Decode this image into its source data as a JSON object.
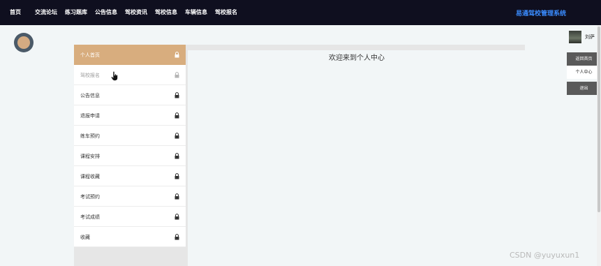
{
  "topbar": {
    "nav": [
      "首页",
      "交流论坛",
      "练习题库",
      "公告信息",
      "驾校资讯",
      "驾校信息",
      "车辆信息",
      "驾校报名"
    ],
    "brand": "易通驾校管理系统"
  },
  "sidebar": {
    "items": [
      {
        "label": "个人首页",
        "state": "active"
      },
      {
        "label": "驾校报名",
        "state": "dim"
      },
      {
        "label": "公告信息",
        "state": "normal"
      },
      {
        "label": "退报申请",
        "state": "normal"
      },
      {
        "label": "练车预约",
        "state": "normal"
      },
      {
        "label": "课程安排",
        "state": "normal"
      },
      {
        "label": "课程收藏",
        "state": "normal"
      },
      {
        "label": "考试预约",
        "state": "normal"
      },
      {
        "label": "考试成绩",
        "state": "normal"
      },
      {
        "label": "收藏",
        "state": "normal"
      }
    ]
  },
  "main": {
    "welcome": "欢迎来到个人中心"
  },
  "user": {
    "name": "刘萨",
    "menu": [
      "返回首页",
      "个人中心",
      "退出"
    ]
  },
  "watermark": "CSDN @yuyuxun1",
  "colors": {
    "topbar_bg": "#0f0f1f",
    "brand": "#3a8cff",
    "active_item": "#d8ad7e",
    "page_bg": "#f2f6f7"
  },
  "icons": {
    "menu_item": "lock-icon",
    "decoration": "orb-icon",
    "pointer": "hand-cursor-icon"
  }
}
